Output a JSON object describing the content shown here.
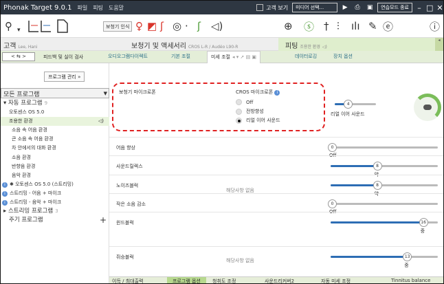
{
  "titlebar": {
    "app_title": "Phonak Target 9.0.1",
    "menu": [
      "파일",
      "피팅",
      "도움말"
    ],
    "customer_view_label": "고객 보기",
    "media_select": "미디어 선택...",
    "practice_mode_btn": "연습모드 종료"
  },
  "toolbar": {
    "hearing_aid_detect": "보청기 인식"
  },
  "patient": {
    "label": "고객",
    "name": "Lee, Hani",
    "devices_label": "보청기 및 액세서리",
    "devices_value": "CROS L-R / Audéo L90-R",
    "fitting_label": "피팅",
    "fitting_program": "조용한 환경"
  },
  "nav": {
    "arrows": "< ⇆ >",
    "steps": [
      "피드백 및 실이 검사",
      "오디오그램다이렉트",
      "기본 조절"
    ],
    "active_tab": "미세 조절",
    "tabs": [
      "데이터로깅",
      "장치 옵션"
    ]
  },
  "left": {
    "program_mgmt_btn": "프로그램 관리 »",
    "program_select": "모든 프로그램",
    "tree": [
      {
        "label": "▾ 자동 프로그램",
        "count": "9",
        "type": "group",
        "indent": 4
      },
      {
        "label": "오토센스 OS 5.0",
        "indent": 12
      },
      {
        "label": "조용한 환경",
        "indent": 12,
        "selected": true
      },
      {
        "label": "소음 속 어음 환경",
        "indent": 16
      },
      {
        "label": "큰 소음 속 어음 환경",
        "indent": 16
      },
      {
        "label": "차 안에서의 대화 환경",
        "indent": 16
      },
      {
        "label": "소음 환경",
        "indent": 16
      },
      {
        "label": "반향음 환경",
        "indent": 16
      },
      {
        "label": "음악 환경",
        "indent": 16
      },
      {
        "label": "✱ 오토센스 OS 5.0 (스트리밍)",
        "indent": 2,
        "info": true
      },
      {
        "label": "스트리밍 - 어음 + 마이크",
        "indent": 2,
        "info": true
      },
      {
        "label": "스트리밍 - 음악 + 마이크",
        "indent": 2,
        "info": true
      },
      {
        "label": "▸ 스트리밍 프로그램",
        "count": "3",
        "type": "group",
        "indent": 4
      },
      {
        "label": "주기 프로그램",
        "type": "group",
        "indent": 12,
        "plus": true
      }
    ]
  },
  "microphone": {
    "label": "보청기 마이크로폰",
    "cros_label": "CROS 마이크로폰",
    "options": [
      "Off",
      "전방향성",
      "리얼 이어 사운드"
    ],
    "selected": "리얼 이어 사운드",
    "slider_value": "4",
    "slider_position": 0.32,
    "result_label": "리얼 이어 사운드"
  },
  "rows": [
    {
      "label": "어음 향상",
      "value": "0",
      "sub": "Off",
      "position": 0.0
    },
    {
      "label": "사운드릴렉스",
      "value": "8",
      "sub": "약",
      "position": 0.42
    },
    {
      "label": "노이즈블럭",
      "value": "8",
      "sub": "약",
      "position": 0.42
    },
    {
      "label": "작은 소음 감소",
      "value": "0",
      "sub": "Off",
      "position": 0.0
    },
    {
      "label": "윈드블럭",
      "value": "16",
      "sub": "중",
      "position": 0.85
    },
    {
      "label": "쥐승블럭",
      "value": "13",
      "sub": "중",
      "position": 0.7
    }
  ],
  "na_text": "해당사항 없음",
  "bottom_tabs": {
    "items": [
      "이득 / 최대출력",
      "프로그램 옵션",
      "청취도 조정",
      "사운드리커버2",
      "자동 미세 조정",
      "Tinnitus balance"
    ],
    "active_index": 1
  },
  "colors": {
    "accent_green": "#b7d98e",
    "slider_blue": "#2d6db4",
    "highlight_red": "#e02020",
    "titlebar_dark": "#2e3742"
  }
}
